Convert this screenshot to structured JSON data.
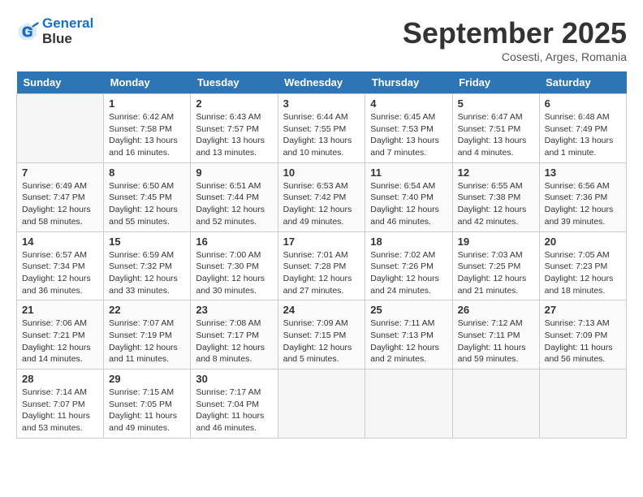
{
  "logo": {
    "text1": "General",
    "text2": "Blue"
  },
  "title": "September 2025",
  "subtitle": "Cosesti, Arges, Romania",
  "days_of_week": [
    "Sunday",
    "Monday",
    "Tuesday",
    "Wednesday",
    "Thursday",
    "Friday",
    "Saturday"
  ],
  "weeks": [
    [
      {
        "day": "",
        "sunrise": "",
        "sunset": "",
        "daylight": ""
      },
      {
        "day": "1",
        "sunrise": "Sunrise: 6:42 AM",
        "sunset": "Sunset: 7:58 PM",
        "daylight": "Daylight: 13 hours and 16 minutes."
      },
      {
        "day": "2",
        "sunrise": "Sunrise: 6:43 AM",
        "sunset": "Sunset: 7:57 PM",
        "daylight": "Daylight: 13 hours and 13 minutes."
      },
      {
        "day": "3",
        "sunrise": "Sunrise: 6:44 AM",
        "sunset": "Sunset: 7:55 PM",
        "daylight": "Daylight: 13 hours and 10 minutes."
      },
      {
        "day": "4",
        "sunrise": "Sunrise: 6:45 AM",
        "sunset": "Sunset: 7:53 PM",
        "daylight": "Daylight: 13 hours and 7 minutes."
      },
      {
        "day": "5",
        "sunrise": "Sunrise: 6:47 AM",
        "sunset": "Sunset: 7:51 PM",
        "daylight": "Daylight: 13 hours and 4 minutes."
      },
      {
        "day": "6",
        "sunrise": "Sunrise: 6:48 AM",
        "sunset": "Sunset: 7:49 PM",
        "daylight": "Daylight: 13 hours and 1 minute."
      }
    ],
    [
      {
        "day": "7",
        "sunrise": "Sunrise: 6:49 AM",
        "sunset": "Sunset: 7:47 PM",
        "daylight": "Daylight: 12 hours and 58 minutes."
      },
      {
        "day": "8",
        "sunrise": "Sunrise: 6:50 AM",
        "sunset": "Sunset: 7:45 PM",
        "daylight": "Daylight: 12 hours and 55 minutes."
      },
      {
        "day": "9",
        "sunrise": "Sunrise: 6:51 AM",
        "sunset": "Sunset: 7:44 PM",
        "daylight": "Daylight: 12 hours and 52 minutes."
      },
      {
        "day": "10",
        "sunrise": "Sunrise: 6:53 AM",
        "sunset": "Sunset: 7:42 PM",
        "daylight": "Daylight: 12 hours and 49 minutes."
      },
      {
        "day": "11",
        "sunrise": "Sunrise: 6:54 AM",
        "sunset": "Sunset: 7:40 PM",
        "daylight": "Daylight: 12 hours and 46 minutes."
      },
      {
        "day": "12",
        "sunrise": "Sunrise: 6:55 AM",
        "sunset": "Sunset: 7:38 PM",
        "daylight": "Daylight: 12 hours and 42 minutes."
      },
      {
        "day": "13",
        "sunrise": "Sunrise: 6:56 AM",
        "sunset": "Sunset: 7:36 PM",
        "daylight": "Daylight: 12 hours and 39 minutes."
      }
    ],
    [
      {
        "day": "14",
        "sunrise": "Sunrise: 6:57 AM",
        "sunset": "Sunset: 7:34 PM",
        "daylight": "Daylight: 12 hours and 36 minutes."
      },
      {
        "day": "15",
        "sunrise": "Sunrise: 6:59 AM",
        "sunset": "Sunset: 7:32 PM",
        "daylight": "Daylight: 12 hours and 33 minutes."
      },
      {
        "day": "16",
        "sunrise": "Sunrise: 7:00 AM",
        "sunset": "Sunset: 7:30 PM",
        "daylight": "Daylight: 12 hours and 30 minutes."
      },
      {
        "day": "17",
        "sunrise": "Sunrise: 7:01 AM",
        "sunset": "Sunset: 7:28 PM",
        "daylight": "Daylight: 12 hours and 27 minutes."
      },
      {
        "day": "18",
        "sunrise": "Sunrise: 7:02 AM",
        "sunset": "Sunset: 7:26 PM",
        "daylight": "Daylight: 12 hours and 24 minutes."
      },
      {
        "day": "19",
        "sunrise": "Sunrise: 7:03 AM",
        "sunset": "Sunset: 7:25 PM",
        "daylight": "Daylight: 12 hours and 21 minutes."
      },
      {
        "day": "20",
        "sunrise": "Sunrise: 7:05 AM",
        "sunset": "Sunset: 7:23 PM",
        "daylight": "Daylight: 12 hours and 18 minutes."
      }
    ],
    [
      {
        "day": "21",
        "sunrise": "Sunrise: 7:06 AM",
        "sunset": "Sunset: 7:21 PM",
        "daylight": "Daylight: 12 hours and 14 minutes."
      },
      {
        "day": "22",
        "sunrise": "Sunrise: 7:07 AM",
        "sunset": "Sunset: 7:19 PM",
        "daylight": "Daylight: 12 hours and 11 minutes."
      },
      {
        "day": "23",
        "sunrise": "Sunrise: 7:08 AM",
        "sunset": "Sunset: 7:17 PM",
        "daylight": "Daylight: 12 hours and 8 minutes."
      },
      {
        "day": "24",
        "sunrise": "Sunrise: 7:09 AM",
        "sunset": "Sunset: 7:15 PM",
        "daylight": "Daylight: 12 hours and 5 minutes."
      },
      {
        "day": "25",
        "sunrise": "Sunrise: 7:11 AM",
        "sunset": "Sunset: 7:13 PM",
        "daylight": "Daylight: 12 hours and 2 minutes."
      },
      {
        "day": "26",
        "sunrise": "Sunrise: 7:12 AM",
        "sunset": "Sunset: 7:11 PM",
        "daylight": "Daylight: 11 hours and 59 minutes."
      },
      {
        "day": "27",
        "sunrise": "Sunrise: 7:13 AM",
        "sunset": "Sunset: 7:09 PM",
        "daylight": "Daylight: 11 hours and 56 minutes."
      }
    ],
    [
      {
        "day": "28",
        "sunrise": "Sunrise: 7:14 AM",
        "sunset": "Sunset: 7:07 PM",
        "daylight": "Daylight: 11 hours and 53 minutes."
      },
      {
        "day": "29",
        "sunrise": "Sunrise: 7:15 AM",
        "sunset": "Sunset: 7:05 PM",
        "daylight": "Daylight: 11 hours and 49 minutes."
      },
      {
        "day": "30",
        "sunrise": "Sunrise: 7:17 AM",
        "sunset": "Sunset: 7:04 PM",
        "daylight": "Daylight: 11 hours and 46 minutes."
      },
      {
        "day": "",
        "sunrise": "",
        "sunset": "",
        "daylight": ""
      },
      {
        "day": "",
        "sunrise": "",
        "sunset": "",
        "daylight": ""
      },
      {
        "day": "",
        "sunrise": "",
        "sunset": "",
        "daylight": ""
      },
      {
        "day": "",
        "sunrise": "",
        "sunset": "",
        "daylight": ""
      }
    ]
  ]
}
